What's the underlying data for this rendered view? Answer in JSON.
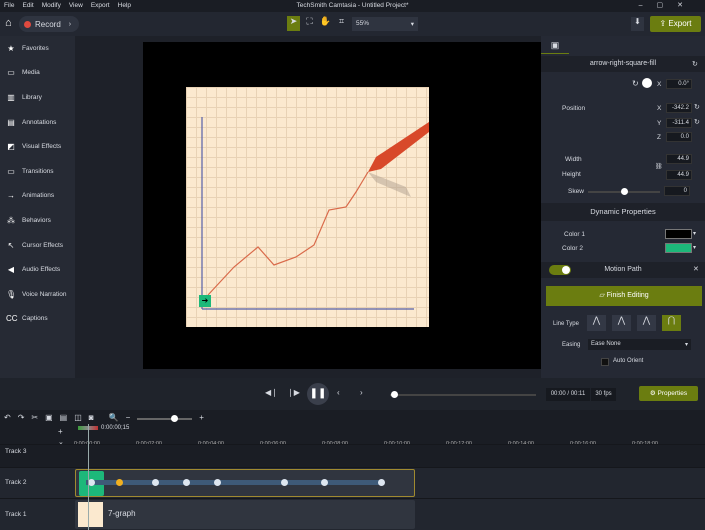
{
  "menu": [
    "File",
    "Edit",
    "Modify",
    "View",
    "Export",
    "Help"
  ],
  "window_title": "TechSmith Camtasia - Untitled Project*",
  "toolbar": {
    "record_label": "Record",
    "zoom": "55%",
    "export_label": "Export"
  },
  "sidebar": {
    "items": [
      {
        "label": "Favorites",
        "icon": "★"
      },
      {
        "label": "Media",
        "icon": "▭"
      },
      {
        "label": "Library",
        "icon": "▥"
      },
      {
        "label": "Annotations",
        "icon": "▤"
      },
      {
        "label": "Visual Effects",
        "icon": "◩"
      },
      {
        "label": "Transitions",
        "icon": "▭"
      },
      {
        "label": "Animations",
        "icon": "→"
      },
      {
        "label": "Behaviors",
        "icon": "⁂"
      },
      {
        "label": "Cursor Effects",
        "icon": "↖"
      },
      {
        "label": "Audio Effects",
        "icon": "◀"
      },
      {
        "label": "Voice Narration",
        "icon": "🎙"
      },
      {
        "label": "Captions",
        "icon": "CC"
      }
    ]
  },
  "properties": {
    "object_name": "arrow-right-square-fill",
    "rotation": "0.0°",
    "rotation_axis": "X",
    "position_label": "Position",
    "x_label": "X",
    "y_label": "Y",
    "z_label": "Z",
    "x": "-342.2",
    "y": "-311.4",
    "z": "0.0",
    "width_label": "Width",
    "height_label": "Height",
    "width": "44.9",
    "height": "44.9",
    "skew_label": "Skew",
    "skew": "0",
    "skew_fraction": 0.5,
    "dynamic_title": "Dynamic Properties",
    "color1_label": "Color 1",
    "color2_label": "Color 2",
    "color1": "#000000",
    "color2": "#1db87a"
  },
  "motion_path": {
    "title": "Motion Path",
    "enabled": true,
    "finish_label": "Finish Editing",
    "line_type_label": "Line Type",
    "easing_label": "Easing",
    "easing_value": "Ease None",
    "auto_orient_label": "Auto Orient"
  },
  "playback": {
    "time": "00:00 / 00:11",
    "fps": "30 fps",
    "properties_label": "Properties"
  },
  "timeline": {
    "playhead_time": "0:00:00;15",
    "ruler": [
      "0:00:00;00",
      "0:00:02;00",
      "0:00:04;00",
      "0:00:06;00",
      "0:00:08;00",
      "0:00:10;00",
      "0:00:12;00",
      "0:00:14;00",
      "0:00:16;00",
      "0:00:18;00"
    ],
    "tracks": [
      "Track 3",
      "Track 2",
      "Track 1"
    ],
    "clip1_label": "7-graph"
  },
  "colors": {
    "accent": "#6b7d10",
    "green": "#1db87a"
  }
}
